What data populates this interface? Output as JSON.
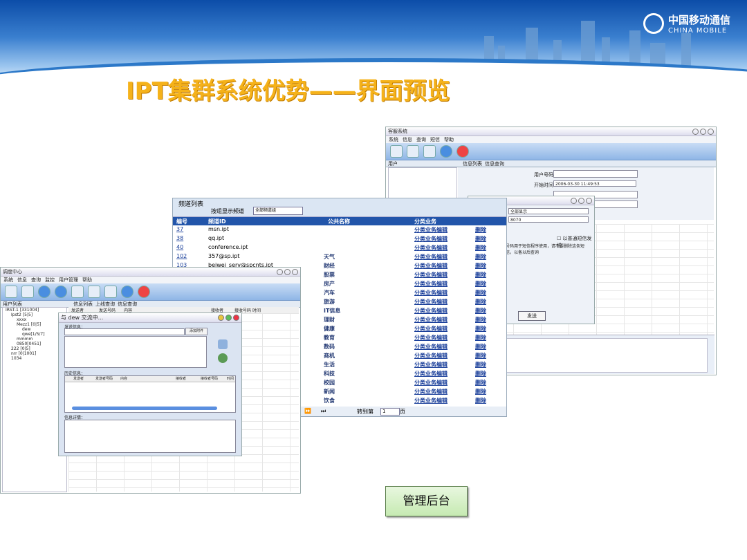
{
  "slide": {
    "title": "IPT集群系统优势——界面预览",
    "logo_cn": "中国移动通信",
    "logo_en": "CHINA MOBILE"
  },
  "left_window": {
    "title": "调度中心",
    "menu": [
      "系统",
      "信息",
      "查询",
      "监控",
      "用户管理",
      "帮助"
    ],
    "left_tab": "用户列表",
    "tabs": [
      "信息列表",
      "上线查询",
      "信息查询"
    ],
    "table_headers": [
      "发送者",
      "发送号码",
      "内容",
      "接收者",
      "接收号码",
      "时间"
    ],
    "tree": [
      "IRST-1 [331004]",
      "Ipst2 [5|5]",
      "xxxx",
      "Mezz1 [0|5]",
      "dew",
      "qwe[1/5/7]",
      "mmmm",
      "0850[0451]",
      "222 [0|5]",
      "nrr [0|1001]",
      "1034"
    ]
  },
  "chat_window": {
    "title": "与 dew 交流中...",
    "send_label": "发送信息：",
    "add_attach": "添加附件",
    "history_label": "历史信息：",
    "history_cols": [
      "发送者",
      "发送者号码",
      "内容",
      "接收者",
      "接收者号码",
      "时间"
    ],
    "detail_label": "信息详情："
  },
  "right_window": {
    "title": "客服系统",
    "menu": [
      "系统",
      "信息",
      "查询",
      "短信",
      "帮助"
    ],
    "left_tab": "用户",
    "tabs": [
      "信息列表",
      "信息查询"
    ],
    "form_labels": [
      "用户号码",
      "开始时间"
    ],
    "start_time": "2006-03-30 11:49:53",
    "select_value": "全部显示",
    "code_value": "8070",
    "checkbox_label": "以普通短信发送",
    "hint": "号码用于短信程序使用，请不要删除这条短信，以备以后查询",
    "send_button": "发送"
  },
  "channel_list": {
    "title": "频道列表",
    "filter_label": "按组显示频道",
    "filter_value": "全部频道组",
    "headers": [
      "编号",
      "频道ID",
      "公共名称",
      "分类业务"
    ],
    "rows": [
      {
        "id": "37",
        "channel": "msn.ipt",
        "name": "",
        "cat": "分类业务编辑",
        "del": "删除"
      },
      {
        "id": "38",
        "channel": "qq.ipt",
        "name": "",
        "cat": "分类业务编辑",
        "del": "删除"
      },
      {
        "id": "40",
        "channel": "conference.ipt",
        "name": "",
        "cat": "分类业务编辑",
        "del": "删除"
      },
      {
        "id": "102",
        "channel": "357@sp.ipt",
        "name": "天气",
        "cat": "分类业务编辑",
        "del": "删除"
      },
      {
        "id": "103",
        "channel": "beiwei_serv@spcnts.ipt",
        "name": "财经",
        "cat": "分类业务编辑",
        "del": "删除"
      },
      {
        "id": "",
        "channel": "",
        "name": "股票",
        "cat": "分类业务编辑",
        "del": "删除"
      },
      {
        "id": "",
        "channel": "",
        "name": "房产",
        "cat": "分类业务编辑",
        "del": "删除"
      },
      {
        "id": "",
        "channel": "",
        "name": "汽车",
        "cat": "分类业务编辑",
        "del": "删除"
      },
      {
        "id": "",
        "channel": "",
        "name": "旅游",
        "cat": "分类业务编辑",
        "del": "删除"
      },
      {
        "id": "",
        "channel": "",
        "name": "IT信息",
        "cat": "分类业务编辑",
        "del": "删除"
      },
      {
        "id": "",
        "channel": "",
        "name": "理财",
        "cat": "分类业务编辑",
        "del": "删除"
      },
      {
        "id": "",
        "channel": "",
        "name": "健康",
        "cat": "分类业务编辑",
        "del": "删除"
      },
      {
        "id": "",
        "channel": "",
        "name": "教育",
        "cat": "分类业务编辑",
        "del": "删除"
      },
      {
        "id": "",
        "channel": "",
        "name": "数码",
        "cat": "分类业务编辑",
        "del": "删除"
      },
      {
        "id": "",
        "channel": "",
        "name": "商机",
        "cat": "分类业务编辑",
        "del": "删除"
      },
      {
        "id": "",
        "channel": "",
        "name": "生活",
        "cat": "分类业务编辑",
        "del": "删除"
      },
      {
        "id": "",
        "channel": "",
        "name": "科技",
        "cat": "分类业务编辑",
        "del": "删除"
      },
      {
        "id": "",
        "channel": "",
        "name": "校园",
        "cat": "分类业务编辑",
        "del": "删除"
      },
      {
        "id": "",
        "channel": "",
        "name": "新闻",
        "cat": "分类业务编辑",
        "del": "删除"
      },
      {
        "id": "",
        "channel": "",
        "name": "饮食",
        "cat": "分类业务编辑",
        "del": "删除"
      }
    ],
    "footer_goto": "转到第",
    "footer_page": "1",
    "footer_unit": "页",
    "nav_next": "⏩",
    "nav_last": "⏭"
  },
  "admin_button": "管理后台"
}
